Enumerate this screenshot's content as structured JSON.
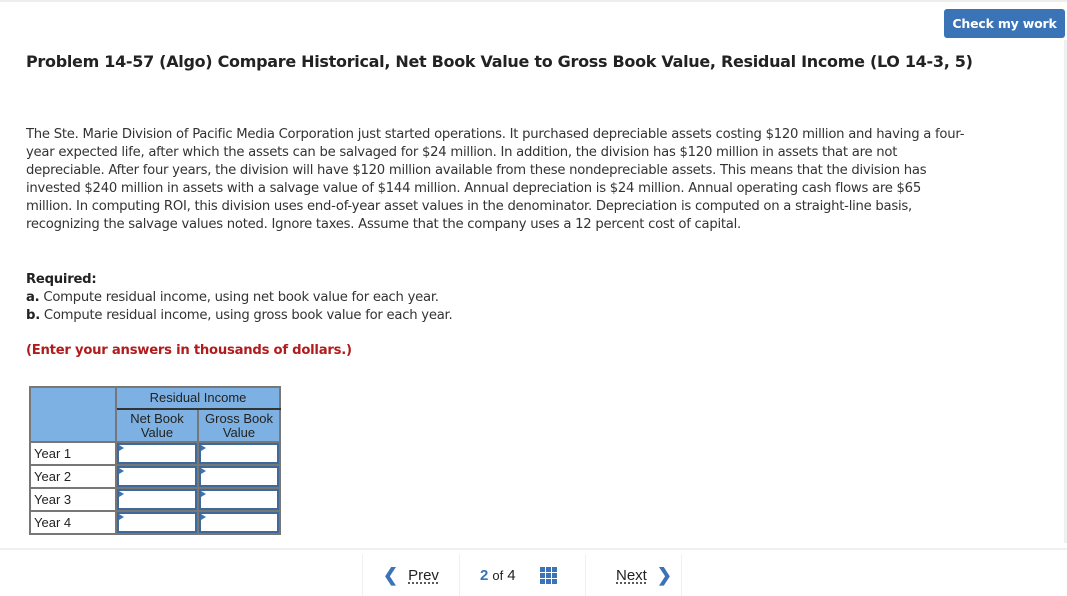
{
  "header": {
    "check_button_label": "Check my work"
  },
  "problem": {
    "title": "Problem 14-57 (Algo) Compare Historical, Net Book Value to Gross Book Value, Residual Income (LO 14-3, 5)",
    "body": "The Ste. Marie Division of Pacific Media Corporation just started operations. It purchased depreciable assets costing $120 million and having a four-year expected life, after which the assets can be salvaged for $24 million. In addition, the division has $120 million in assets that are not depreciable. After four years, the division will have $120 million available from these nondepreciable assets. This means that the division has invested $240 million in assets with a salvage value of $144 million. Annual depreciation is $24 million. Annual operating cash flows are $65 million. In computing ROI, this division uses end-of-year asset values in the denominator. Depreciation is computed on a straight-line basis, recognizing the salvage values noted. Ignore taxes. Assume that the company uses a 12 percent cost of capital.",
    "required_heading": "Required:",
    "requirements": [
      {
        "letter": "a.",
        "text": " Compute residual income, using net book value for each year."
      },
      {
        "letter": "b.",
        "text": " Compute residual income, using gross book value for each year."
      }
    ],
    "instruction": "(Enter your answers in thousands of dollars.)"
  },
  "table": {
    "group_header": "Residual Income",
    "columns": [
      "Net Book Value",
      "Gross Book Value"
    ],
    "rows": [
      {
        "label": "Year 1",
        "net_book_value": "",
        "gross_book_value": ""
      },
      {
        "label": "Year 2",
        "net_book_value": "",
        "gross_book_value": ""
      },
      {
        "label": "Year 3",
        "net_book_value": "",
        "gross_book_value": ""
      },
      {
        "label": "Year 4",
        "net_book_value": "",
        "gross_book_value": ""
      }
    ]
  },
  "pager": {
    "prev_label": "Prev",
    "next_label": "Next",
    "current_page": "2",
    "of_label": "of",
    "total_pages": "4",
    "grid_icon": "grid-icon"
  },
  "colors": {
    "accent": "#3a73b6",
    "table_header": "#7eb1e3",
    "instruction_red": "#b01c1c"
  }
}
